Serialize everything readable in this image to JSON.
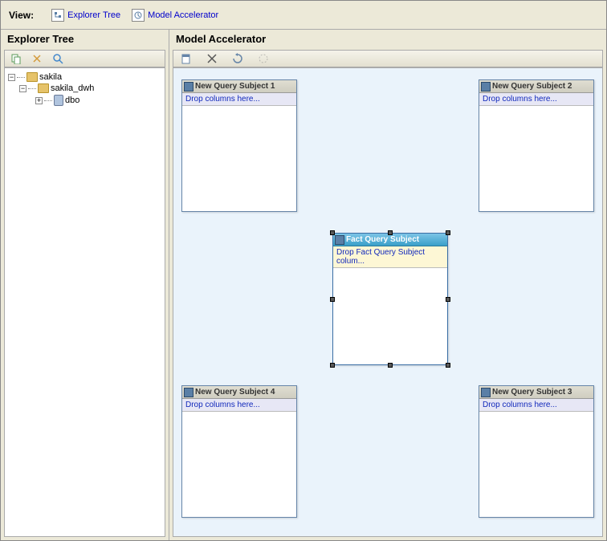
{
  "viewbar": {
    "label": "View:",
    "tabs": [
      {
        "label": "Explorer Tree"
      },
      {
        "label": "Model Accelerator"
      }
    ]
  },
  "explorer": {
    "title": "Explorer Tree",
    "tree": {
      "root": "sakila",
      "child": "sakila_dwh",
      "grandchild": "dbo"
    }
  },
  "accelerator": {
    "title": "Model Accelerator",
    "subjects": {
      "tl": {
        "title": "New Query Subject 1",
        "drop": "Drop columns here..."
      },
      "tr": {
        "title": "New Query Subject 2",
        "drop": "Drop columns here..."
      },
      "center": {
        "title": "Fact Query Subject",
        "drop": "Drop Fact Query Subject colum..."
      },
      "bl": {
        "title": "New Query Subject 4",
        "drop": "Drop columns here..."
      },
      "br": {
        "title": "New Query Subject 3",
        "drop": "Drop columns here..."
      }
    }
  }
}
